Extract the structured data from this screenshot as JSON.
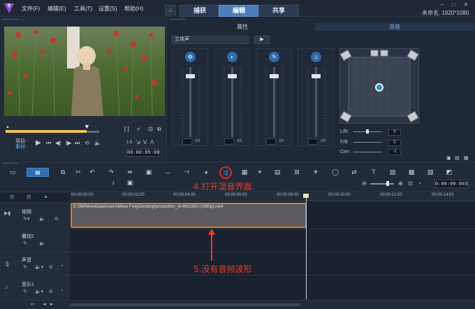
{
  "menu": {
    "file": "文件(F)",
    "edit": "编辑(E)",
    "tools": "工具(T)",
    "settings": "设置(S)",
    "help": "帮助(H)"
  },
  "tabs": {
    "capture": "捕获",
    "edit": "编辑",
    "share": "共享"
  },
  "project": {
    "info": "未命名, 1920*1080"
  },
  "preview": {
    "project_label": "项目-",
    "clip_label": "素材-",
    "timecode": "00:00:09:00",
    "zoom_glyph": "1.0",
    "a_label": "A",
    "v_label": "V"
  },
  "mixer": {
    "tab_properties": "属性",
    "tab_mixing": "混音",
    "stereo_option": "立体声",
    "db_unit": "dB",
    "lr_label": "L/R",
    "fb_label": "F/B",
    "cen_label": "Cen",
    "lr_value": "0",
    "fb_value": "0",
    "cen_value": "-1"
  },
  "timeline": {
    "ticks": [
      "00:00:00:00",
      "00:00:02:00",
      "00:00:04:00",
      "00:00:06:00",
      "00:00:08:00",
      "00:00:10:00",
      "00:00:12:00",
      "00:00:14:00"
    ],
    "zoom_time": "0:00:09:003",
    "tracks": {
      "video": "视频",
      "overlay": "叠加1",
      "voice": "声音",
      "music": "音乐1"
    },
    "clip_path": "E:\\360MoveData\\Users\\Muse Frog\\Desktop\\production_id-4811920 (1080p).mp4"
  },
  "annotations": {
    "step4": "4.打开混音界面",
    "step5": "5.没有音频波形"
  },
  "colors": {
    "accent": "#4a7dba",
    "annotation_red": "#e53a2c",
    "clip_border": "#e0772a"
  }
}
